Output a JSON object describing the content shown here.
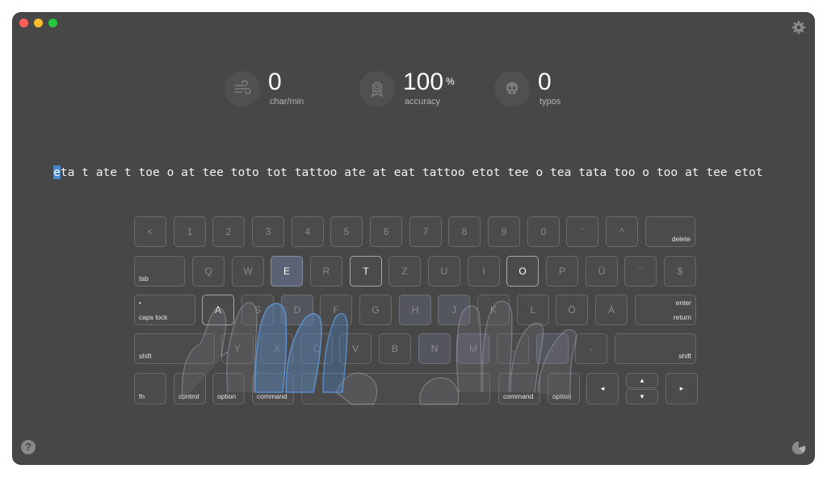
{
  "window": {
    "title": ""
  },
  "stats": [
    {
      "value": "0",
      "unit": "",
      "label": "char/min",
      "icon": "wind-icon"
    },
    {
      "value": "100",
      "unit": "%",
      "label": "accuracy",
      "icon": "award-ribbon-icon"
    },
    {
      "value": "0",
      "unit": "",
      "label": "typos",
      "icon": "skull-icon"
    }
  ],
  "lesson": {
    "cursor_char": "e",
    "remaining_text": "ta t ate t toe o at tee toto tot tattoo ate at eat tattoo etot tee o tea tata too o too at tee etot"
  },
  "keyboard": {
    "row1": [
      "<",
      "1",
      "2",
      "3",
      "4",
      "5",
      "6",
      "7",
      "8",
      "9",
      "0",
      "'",
      "^"
    ],
    "delete": "delete",
    "tab": "tab",
    "row2": [
      "Q",
      "W",
      "E",
      "R",
      "T",
      "Z",
      "U",
      "I",
      "O",
      "P",
      "Ü",
      "¨",
      "$"
    ],
    "caps_dot": "•",
    "caps": "caps lock",
    "row3": [
      "A",
      "S",
      "D",
      "F",
      "G",
      "H",
      "J",
      "K",
      "L",
      "Ö",
      "Ä"
    ],
    "enter": "enter",
    "return": "return",
    "shift_left": "shift",
    "row4": [
      "Y",
      "X",
      "C",
      "V",
      "B",
      "N",
      "M",
      ",",
      ".",
      "-"
    ],
    "shift_right": "shift",
    "fn": "fn",
    "control": "control",
    "option_left": "option",
    "command_left": "command",
    "command_right": "command",
    "option_right": "option",
    "arrow_left": "◂",
    "arrow_up": "▴",
    "arrow_down": "▾",
    "arrow_right": "▸"
  },
  "colors": {
    "accent": "#4a86c8",
    "background": "#474747"
  }
}
